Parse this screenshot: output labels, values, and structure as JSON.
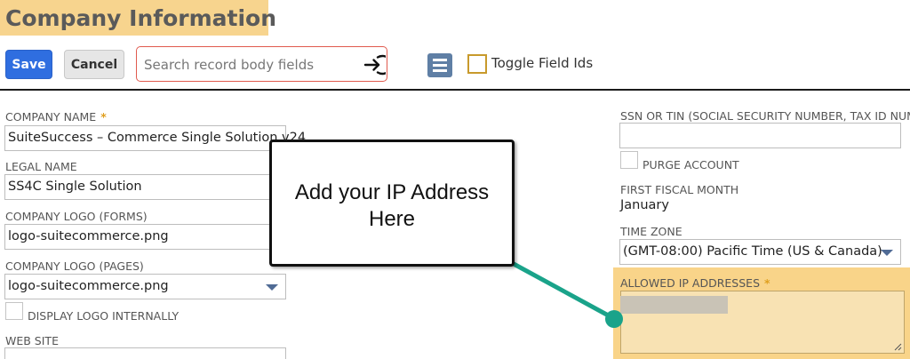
{
  "header": {
    "title": "Company Information"
  },
  "toolbar": {
    "save_label": "Save",
    "cancel_label": "Cancel",
    "search_placeholder": "Search record body fields",
    "toggle_label": "Toggle Field Ids"
  },
  "left": {
    "company_name": {
      "label": "COMPANY NAME",
      "required": "*",
      "value": "SuiteSuccess – Commerce Single Solution v24"
    },
    "legal_name": {
      "label": "LEGAL NAME",
      "value": "SS4C Single Solution"
    },
    "logo_forms": {
      "label": "COMPANY LOGO (FORMS)",
      "value": "logo-suitecommerce.png"
    },
    "logo_pages": {
      "label": "COMPANY LOGO (PAGES)",
      "value": "logo-suitecommerce.png"
    },
    "display_logo": {
      "label": "DISPLAY LOGO INTERNALLY"
    },
    "web_site": {
      "label": "WEB SITE"
    }
  },
  "right": {
    "ssn": {
      "label": "SSN OR TIN (SOCIAL SECURITY NUMBER, TAX ID NUMBER)",
      "value": ""
    },
    "purge": {
      "label": "PURGE ACCOUNT"
    },
    "fiscal": {
      "label": "FIRST FISCAL MONTH",
      "value": "January"
    },
    "timezone": {
      "label": "TIME ZONE",
      "value": "(GMT-08:00) Pacific Time (US & Canada)"
    },
    "allowed_ip": {
      "label": "ALLOWED IP ADDRESSES",
      "required": "*"
    }
  },
  "callout": {
    "line1": "Add your IP Address",
    "line2": "Here"
  },
  "colors": {
    "highlight": "#f9d489",
    "primary_button": "#2f6ee0",
    "arrow": "#1aa38a",
    "required": "#e0a020"
  },
  "icons": {
    "search_go": "arrow-right-circle-icon",
    "list": "list-icon"
  }
}
